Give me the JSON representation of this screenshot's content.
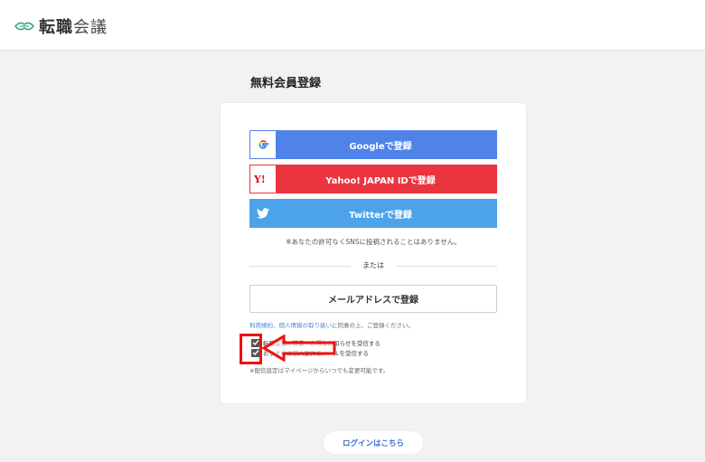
{
  "header": {
    "logo_main": "転職",
    "logo_sub": "会議"
  },
  "page": {
    "title": "無料会員登録"
  },
  "sns": {
    "google_label": "Googleで登録",
    "yahoo_label": "Yahoo! JAPAN IDで登録",
    "twitter_label": "Twitterで登録",
    "note": "※あなたの許可なくSNSに投稿されることはありません。"
  },
  "divider": {
    "label": "または"
  },
  "email": {
    "label": "メールアドレスで登録"
  },
  "terms": {
    "link1": "利用規約",
    "sep": "、",
    "link2": "個人情報の取り扱い",
    "suffix": "に同意の上、ご登録ください。"
  },
  "options": [
    {
      "label": "転職会議の新着・お得なお知らせを受信する",
      "checked": true
    },
    {
      "label": "おすすめの求人案件のメールを受信する",
      "checked": true
    }
  ],
  "delivery_note": "※配信設定はマイページからいつでも変更可能です。",
  "login": {
    "label": "ログインはこちら"
  },
  "colors": {
    "google": "#4f83e8",
    "yahoo": "#ea3540",
    "twitter": "#4da3ea",
    "annotation": "#e11111"
  }
}
